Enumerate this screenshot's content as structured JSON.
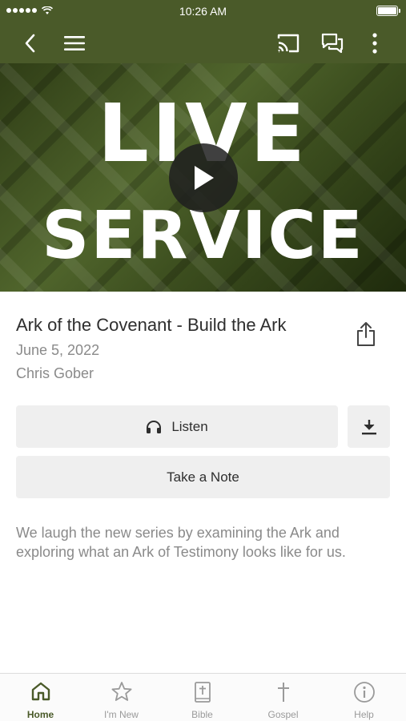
{
  "status_bar": {
    "time": "10:26 AM"
  },
  "hero": {
    "line1": "LIVE",
    "line2": "SERVICE"
  },
  "sermon": {
    "title": "Ark of the Covenant - Build the Ark",
    "date": "June 5, 2022",
    "speaker": "Chris Gober",
    "description": "We laugh the new series by examining the Ark and exploring what an Ark of Testimony looks like for us."
  },
  "actions": {
    "listen_label": "Listen",
    "note_label": "Take a Note"
  },
  "tabs": [
    {
      "label": "Home",
      "icon": "home-icon",
      "active": true
    },
    {
      "label": "I'm New",
      "icon": "star-icon",
      "active": false
    },
    {
      "label": "Bible",
      "icon": "bible-icon",
      "active": false
    },
    {
      "label": "Gospel",
      "icon": "cross-icon",
      "active": false
    },
    {
      "label": "Help",
      "icon": "info-icon",
      "active": false
    }
  ],
  "colors": {
    "brand": "#4a5a29",
    "button_bg": "#efefef",
    "muted_text": "#8a8a8a"
  }
}
